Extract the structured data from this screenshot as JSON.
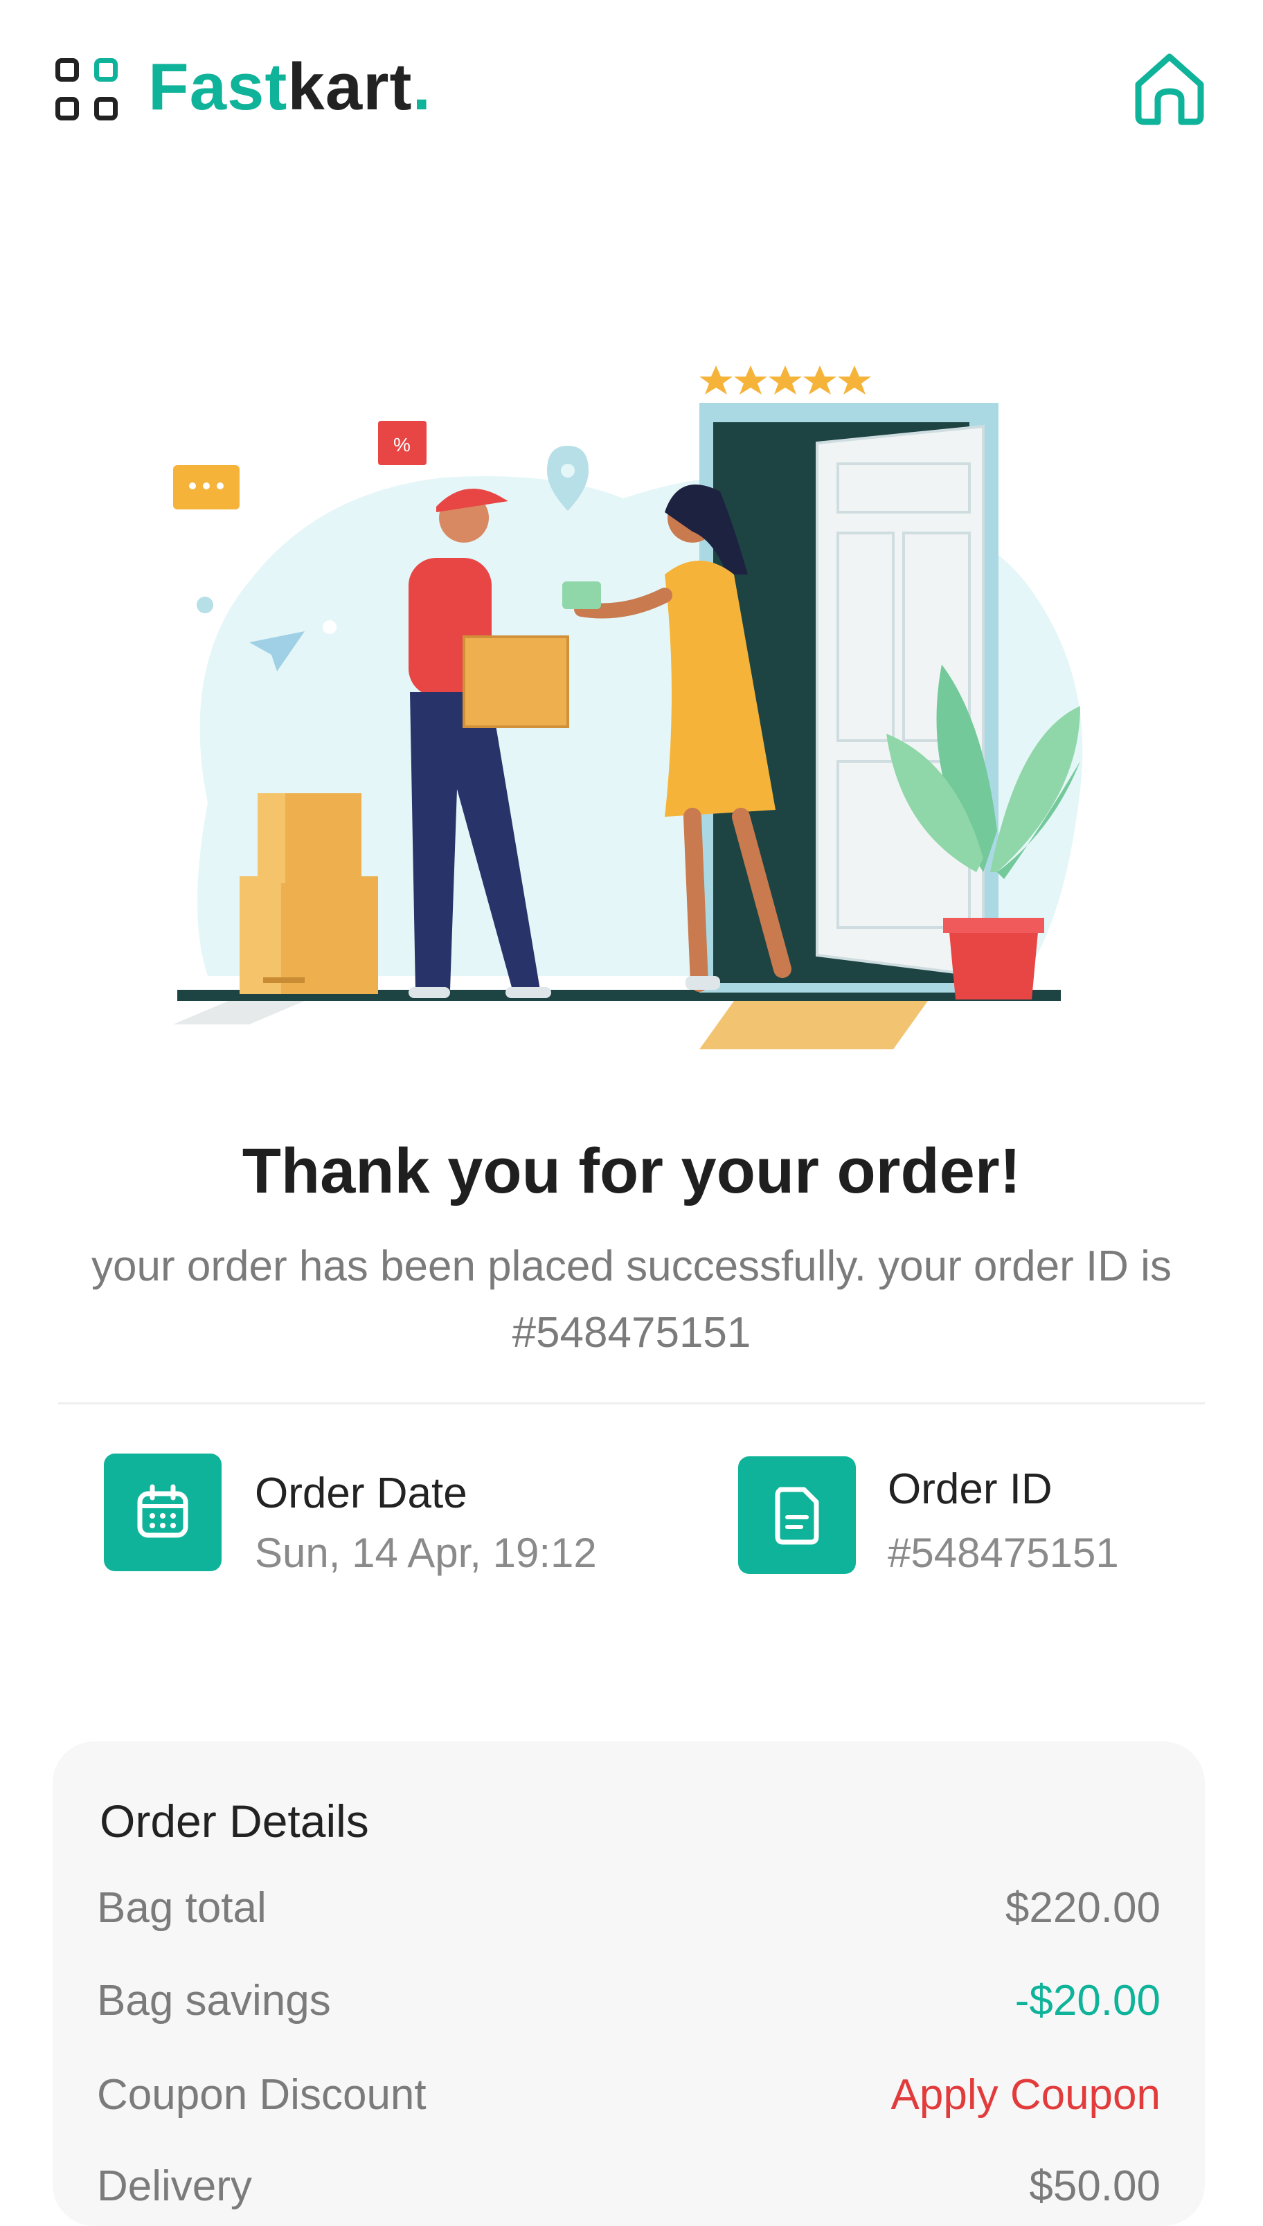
{
  "brand": {
    "part1": "Fast",
    "part2": "kart",
    "part3": "."
  },
  "colors": {
    "accent": "#0fb39a",
    "danger": "#e23b3b",
    "text": "#222222",
    "muted": "#7b7b7b"
  },
  "header": {
    "home_icon": "home-icon",
    "menu_icon": "app-grid-icon"
  },
  "hero": {
    "stars": 5
  },
  "confirmation": {
    "title": "Thank you for your order!",
    "message": "your order has been placed successfully. your order ID is #548475151"
  },
  "info": {
    "date": {
      "icon": "calendar-icon",
      "label": "Order Date",
      "value": "Sun, 14 Apr, 19:12"
    },
    "id": {
      "icon": "document-icon",
      "label": "Order ID",
      "value": "#548475151"
    }
  },
  "order_details": {
    "title": "Order Details",
    "rows": [
      {
        "label": "Bag total",
        "value": "$220.00"
      },
      {
        "label": "Bag savings",
        "value": "-$20.00"
      },
      {
        "label": "Coupon Discount",
        "value": "Apply Coupon"
      },
      {
        "label": "Delivery",
        "value": "$50.00"
      }
    ]
  }
}
